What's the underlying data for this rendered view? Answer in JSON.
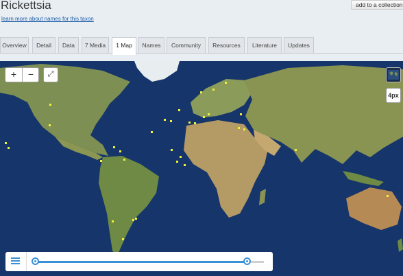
{
  "page": {
    "title": "Rickettsia",
    "subtitle_link": "learn more about names for this taxon",
    "collect_button": "add to a collection"
  },
  "tabs": [
    {
      "label": "Overview"
    },
    {
      "label": "Detail"
    },
    {
      "label": "Data"
    },
    {
      "label": "7 Media"
    },
    {
      "label": "1 Map",
      "active": true
    },
    {
      "label": "Names"
    },
    {
      "label": "Community"
    },
    {
      "label": "Resources"
    },
    {
      "label": "Literature"
    },
    {
      "label": "Updates"
    }
  ],
  "map": {
    "zoom_in": "+",
    "zoom_out": "−",
    "fullscreen_icon": "fullscreen-icon",
    "layers_icon": "layers-icon",
    "pixel_toggle_label": "4px",
    "slider_menu_icon": "menu-icon",
    "colors": {
      "ocean": "#16356a",
      "land": "#8a9b5a",
      "ice": "#e8edf0",
      "point": "#f2f23a",
      "accent": "#3a8fd6"
    }
  }
}
